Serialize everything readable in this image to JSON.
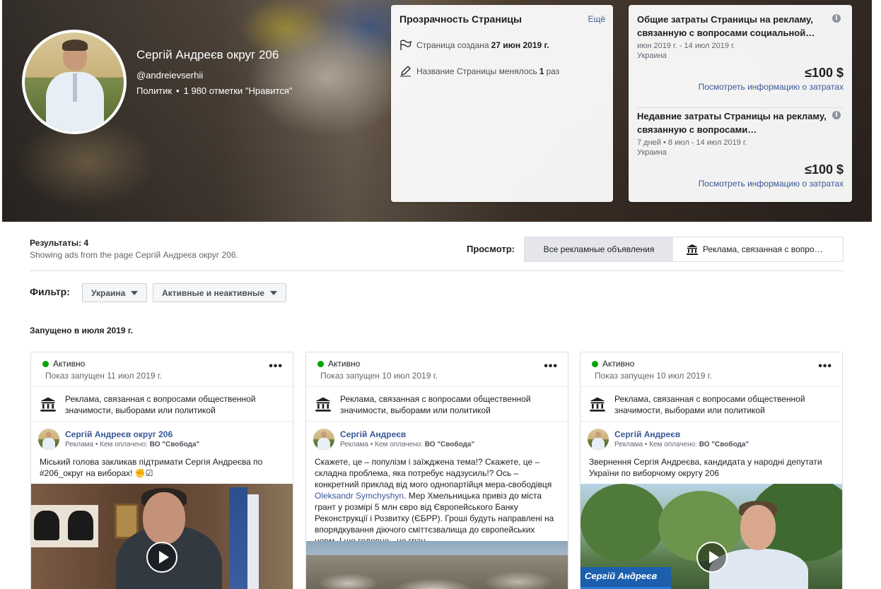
{
  "page": {
    "name": "Сергій Андреєв округ 206",
    "handle": "@andreievserhii",
    "category": "Политик",
    "likes": "1 980 отметки \"Нравится\""
  },
  "transparency": {
    "title": "Прозрачность Страницы",
    "more": "Ещё",
    "created_label": "Страница создана",
    "created_date": "27 июн 2019 г.",
    "renamed_label": "Название Страницы менялось",
    "renamed_count": "1",
    "renamed_suffix": "раз"
  },
  "spend": [
    {
      "title": "Общие затраты Страницы на рекламу, связанную с вопросами социальной…",
      "dates": "июн 2019 г. - 14 июл 2019 г.",
      "country": "Украина",
      "amount": "≤100 $",
      "link": "Посмотреть информацию о затратах"
    },
    {
      "title": "Недавние затраты Страницы на рекламу, связанную с вопросами…",
      "dates": "7 дней • 8 июл - 14 июл 2019 г.",
      "country": "Украина",
      "amount": "≤100 $",
      "link": "Посмотреть информацию о затратах"
    }
  ],
  "results": {
    "count": "Результаты: 4",
    "subtitle": "Showing ads from the page Сергій Андреєв округ 206.",
    "view_label": "Просмотр:",
    "view_all": "Все рекламные объявления",
    "view_political": "Реклама, связанная с вопро…"
  },
  "filters": {
    "label": "Фильтр:",
    "country": "Украина",
    "status": "Активные и неактивные"
  },
  "launched_heading": "Запущено в июля 2019 г.",
  "ads": [
    {
      "status": "Активно",
      "started": "Показ запущен 11 июл 2019 г.",
      "category": "Реклама, связанная с вопросами общественной значимости, выборами или политикой",
      "page": "Сергій Андреєв округ 206",
      "paid_prefix": "Реклама • Кем оплачено:",
      "paid_by": "ВО \"Свобода\"",
      "text": "Міський голова закликав підтримати Сергія Андреєва по #206_округ на виборах! ✊☑"
    },
    {
      "status": "Активно",
      "started": "Показ запущен 10 июл 2019 г.",
      "category": "Реклама, связанная с вопросами общественной значимости, выборами или политикой",
      "page": "Сергій Андреєв",
      "paid_prefix": "Реклама • Кем оплачено:",
      "paid_by": "ВО \"Свобода\"",
      "text_before": "Скажете, це – популізм і заїжджена тема!? Скажете, це – складна проблема, яка потребує надзусиль!? Ось – конкретний приклад від мого однопартійця мера-свободівця ",
      "text_link": "Oleksandr Symchyshyn",
      "text_after": ". Мер Хмельницька привіз до міста грант у розмірі 5 млн євро від Європейського Банку Реконструкції і Розвитку (ЄБРР). Гроші будуть направлені на впорядкування діючого сміттєзвалища до європейських норм. І що головне - це гран…"
    },
    {
      "status": "Активно",
      "started": "Показ запущен 10 июл 2019 г.",
      "category": "Реклама, связанная с вопросами общественной значимости, выборами или политикой",
      "page": "Сергій Андреєв",
      "paid_prefix": "Реклама • Кем оплачено:",
      "paid_by": "ВО \"Свобода\"",
      "text": "Звернення Сергія Андреєва, кандидата у народні депутати України по виборчому округу 206",
      "video_caption": "Сергій Андреєв"
    }
  ],
  "colors": {
    "link": "#385898",
    "active_dot": "#00a400",
    "toggle_active": "#e4e6eb"
  }
}
